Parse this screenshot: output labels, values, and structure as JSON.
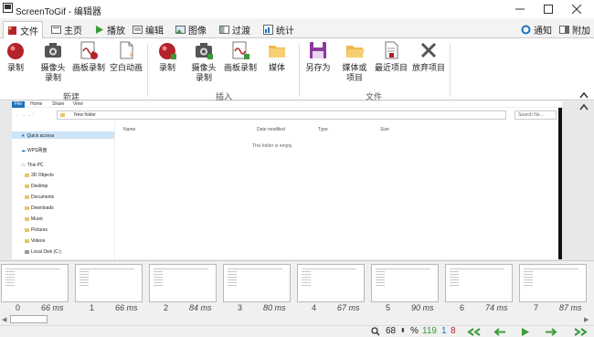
{
  "window": {
    "title": "ScreenToGif - 编辑器"
  },
  "tabs": [
    {
      "label": "文件"
    },
    {
      "label": "主页"
    },
    {
      "label": "播放"
    },
    {
      "label": "编辑"
    },
    {
      "label": "图像"
    },
    {
      "label": "过渡"
    },
    {
      "label": "统计"
    }
  ],
  "top_right": {
    "notify": "通知",
    "attach": "附加"
  },
  "ribbon": {
    "new_group": {
      "label": "新建",
      "buttons": [
        {
          "label": "录制"
        },
        {
          "label": "摄像头\n录制"
        },
        {
          "label": "画板录制"
        },
        {
          "label": "空白动画"
        }
      ]
    },
    "insert_group": {
      "label": "插入",
      "buttons": [
        {
          "label": "录制"
        },
        {
          "label": "摄像头\n录制"
        },
        {
          "label": "画板录制"
        },
        {
          "label": "媒体"
        }
      ]
    },
    "file_group": {
      "label": "文件",
      "buttons": [
        {
          "label": "另存为"
        },
        {
          "label": "媒体或\n项目"
        },
        {
          "label": "最近项目"
        },
        {
          "label": "放弃项目"
        }
      ]
    }
  },
  "explorer": {
    "tabs": [
      "File",
      "Home",
      "Share",
      "View"
    ],
    "address": "New folder",
    "search_placeholder": "Search Ne...",
    "columns": [
      "Name",
      "Date modified",
      "Type",
      "Size"
    ],
    "empty_text": "This folder is empty.",
    "nav": [
      "Quick access",
      "WPS网盘",
      "This PC",
      "3D Objects",
      "Desktop",
      "Documents",
      "Downloads",
      "Music",
      "Pictures",
      "Videos",
      "Local Disk (C:)"
    ]
  },
  "frames": [
    {
      "index": "0",
      "delay": "66 ms"
    },
    {
      "index": "1",
      "delay": "66 ms"
    },
    {
      "index": "2",
      "delay": "84 ms"
    },
    {
      "index": "3",
      "delay": "80 ms"
    },
    {
      "index": "4",
      "delay": "67 ms"
    },
    {
      "index": "5",
      "delay": "90 ms"
    },
    {
      "index": "6",
      "delay": "74 ms"
    },
    {
      "index": "7",
      "delay": "87 ms"
    }
  ],
  "status": {
    "zoom": "68",
    "percent": "%",
    "total_frames": "119",
    "selected": "1",
    "current": "8"
  },
  "colors": {
    "accent": "#1e73be",
    "record_red": "#b3222a",
    "green": "#3a9a3a",
    "save_purple": "#8e3a9e",
    "folder_yellow": "#f0b94a",
    "nav_green": "#3d9b3d"
  }
}
